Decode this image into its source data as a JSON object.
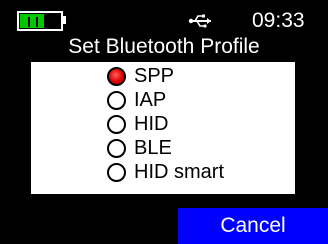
{
  "status_bar": {
    "time": "09:33",
    "battery_level": 0.6,
    "battery_icon": "battery-icon",
    "usb_icon": "usb-icon",
    "colors": {
      "battery_fill": "#00c800"
    }
  },
  "title": "Set Bluetooth Profile",
  "profiles": [
    {
      "label": "SPP",
      "selected": true
    },
    {
      "label": "IAP",
      "selected": false
    },
    {
      "label": "HID",
      "selected": false
    },
    {
      "label": "BLE",
      "selected": false
    },
    {
      "label": "HID smart",
      "selected": false
    }
  ],
  "selected_profile": "SPP",
  "cancel_label": "Cancel",
  "colors": {
    "background": "#000000",
    "panel": "#ffffff",
    "cancel_button": "#0000ff",
    "radio_selected": "#e00000"
  }
}
